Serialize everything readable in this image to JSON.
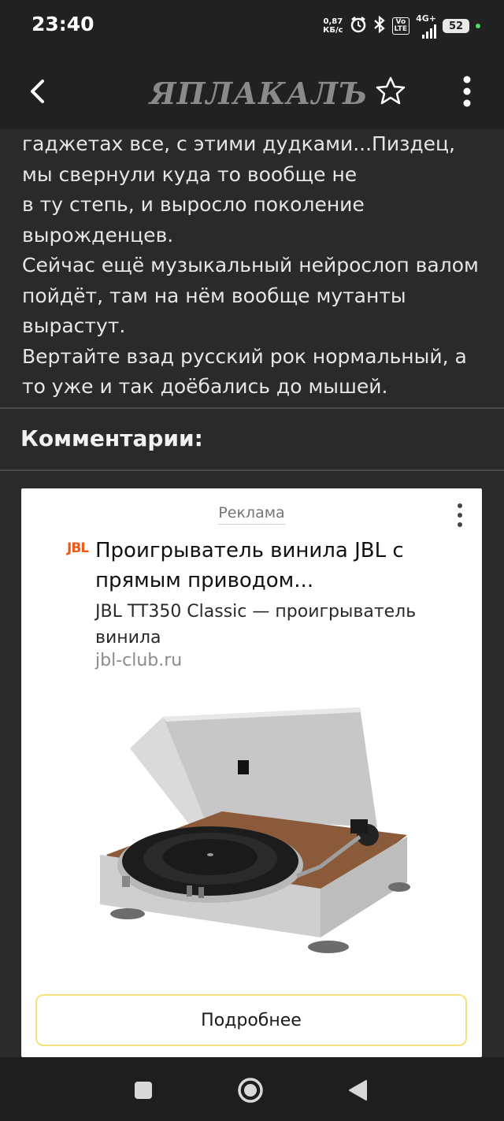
{
  "status_bar": {
    "time": "23:40",
    "net_speed_value": "0,87",
    "net_speed_unit": "КБ/с",
    "volte_top": "Vo",
    "volte_bottom": "LTE",
    "network": "4G+",
    "battery": "52",
    "icons": [
      "alarm-icon",
      "bluetooth-icon",
      "volte-icon",
      "signal-icon",
      "battery-icon"
    ]
  },
  "app_bar": {
    "logo": "ЯПЛАКАЛЪ",
    "icons": [
      "back-icon",
      "star-icon",
      "more-vert-icon"
    ]
  },
  "article": {
    "paragraphs": [
      "гаджетах все, с этими дудками...Пиздец, мы свернули куда то вообще не",
      "в ту степь, и выросло поколение вырожденцев.",
      "Сейчас ещё музыкальный нейрослоп валом пойдёт, там на нём вообще мутанты вырастут.",
      "Вертайте взад русский рок нормальный, а то уже и так доёбались до мышей."
    ]
  },
  "comments": {
    "title": "Комментарии:"
  },
  "ad": {
    "label": "Реклама",
    "brand_logo": "JBL",
    "title": "Проигрыватель винила JBL с прямым приводом...",
    "description": "JBL TT350 Classic — проигрыватель винила",
    "domain": "jbl-club.ru",
    "cta": "Подробнее"
  },
  "nav_bar": {
    "icons": [
      "recents-square-icon",
      "home-circle-icon",
      "back-triangle-icon"
    ]
  },
  "colors": {
    "background": "#2a2a2a",
    "bars": "#212121",
    "text": "#e6e6e6",
    "ad_button_border": "#f6e27a",
    "jbl_orange": "#ee5a1b"
  }
}
